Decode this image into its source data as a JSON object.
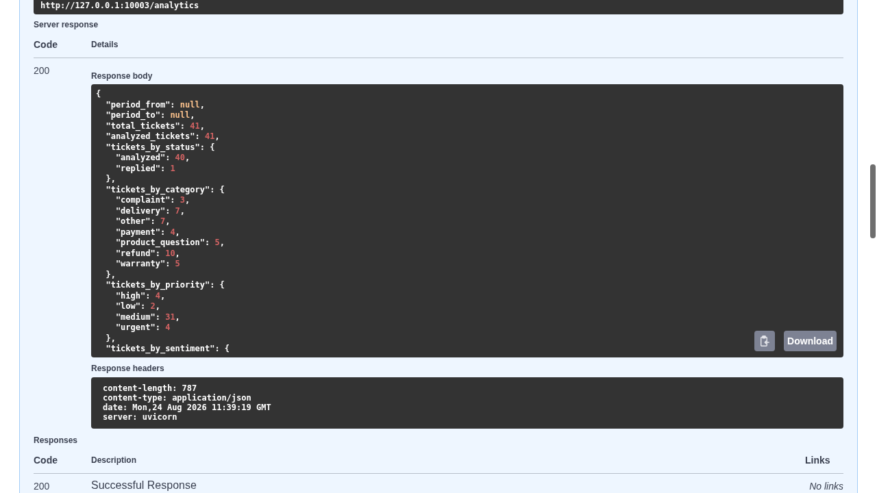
{
  "request_url": "http://127.0.0.1:10003/analytics",
  "server_response": {
    "title": "Server response",
    "columns": [
      "Code",
      "Details"
    ],
    "code": "200",
    "response_body": {
      "label": "Response body",
      "lines": [
        {
          "text": "{"
        },
        {
          "text": "  \"period_from\": ",
          "value": "null",
          "kind": "literal",
          "tail": ","
        },
        {
          "text": "  \"period_to\": ",
          "value": "null",
          "kind": "literal",
          "tail": ","
        },
        {
          "text": "  \"total_tickets\": ",
          "value": "41",
          "kind": "number",
          "tail": ","
        },
        {
          "text": "  \"analyzed_tickets\": ",
          "value": "41",
          "kind": "number",
          "tail": ","
        },
        {
          "text": "  \"tickets_by_status\": {"
        },
        {
          "text": "    \"analyzed\": ",
          "value": "40",
          "kind": "number",
          "tail": ","
        },
        {
          "text": "    \"replied\": ",
          "value": "1",
          "kind": "number"
        },
        {
          "text": "  },"
        },
        {
          "text": "  \"tickets_by_category\": {"
        },
        {
          "text": "    \"complaint\": ",
          "value": "3",
          "kind": "number",
          "tail": ","
        },
        {
          "text": "    \"delivery\": ",
          "value": "7",
          "kind": "number",
          "tail": ","
        },
        {
          "text": "    \"other\": ",
          "value": "7",
          "kind": "number",
          "tail": ","
        },
        {
          "text": "    \"payment\": ",
          "value": "4",
          "kind": "number",
          "tail": ","
        },
        {
          "text": "    \"product_question\": ",
          "value": "5",
          "kind": "number",
          "tail": ","
        },
        {
          "text": "    \"refund\": ",
          "value": "10",
          "kind": "number",
          "tail": ","
        },
        {
          "text": "    \"warranty\": ",
          "value": "5",
          "kind": "number"
        },
        {
          "text": "  },"
        },
        {
          "text": "  \"tickets_by_priority\": {"
        },
        {
          "text": "    \"high\": ",
          "value": "4",
          "kind": "number",
          "tail": ","
        },
        {
          "text": "    \"low\": ",
          "value": "2",
          "kind": "number",
          "tail": ","
        },
        {
          "text": "    \"medium\": ",
          "value": "31",
          "kind": "number",
          "tail": ","
        },
        {
          "text": "    \"urgent\": ",
          "value": "4",
          "kind": "number"
        },
        {
          "text": "  },"
        },
        {
          "text": "  \"tickets_by_sentiment\": {"
        }
      ],
      "download_button": "Download"
    },
    "response_headers": {
      "label": "Response headers",
      "lines": [
        "content-length: 787",
        "content-type: application/json",
        "date: Mon,24 Aug 2026 11:39:19 GMT",
        "server: uvicorn"
      ]
    }
  },
  "responses": {
    "title": "Responses",
    "columns": [
      "Code",
      "Description",
      "Links"
    ],
    "rows": [
      {
        "code": "200",
        "description": "Successful Response",
        "links": "No links"
      }
    ]
  }
}
